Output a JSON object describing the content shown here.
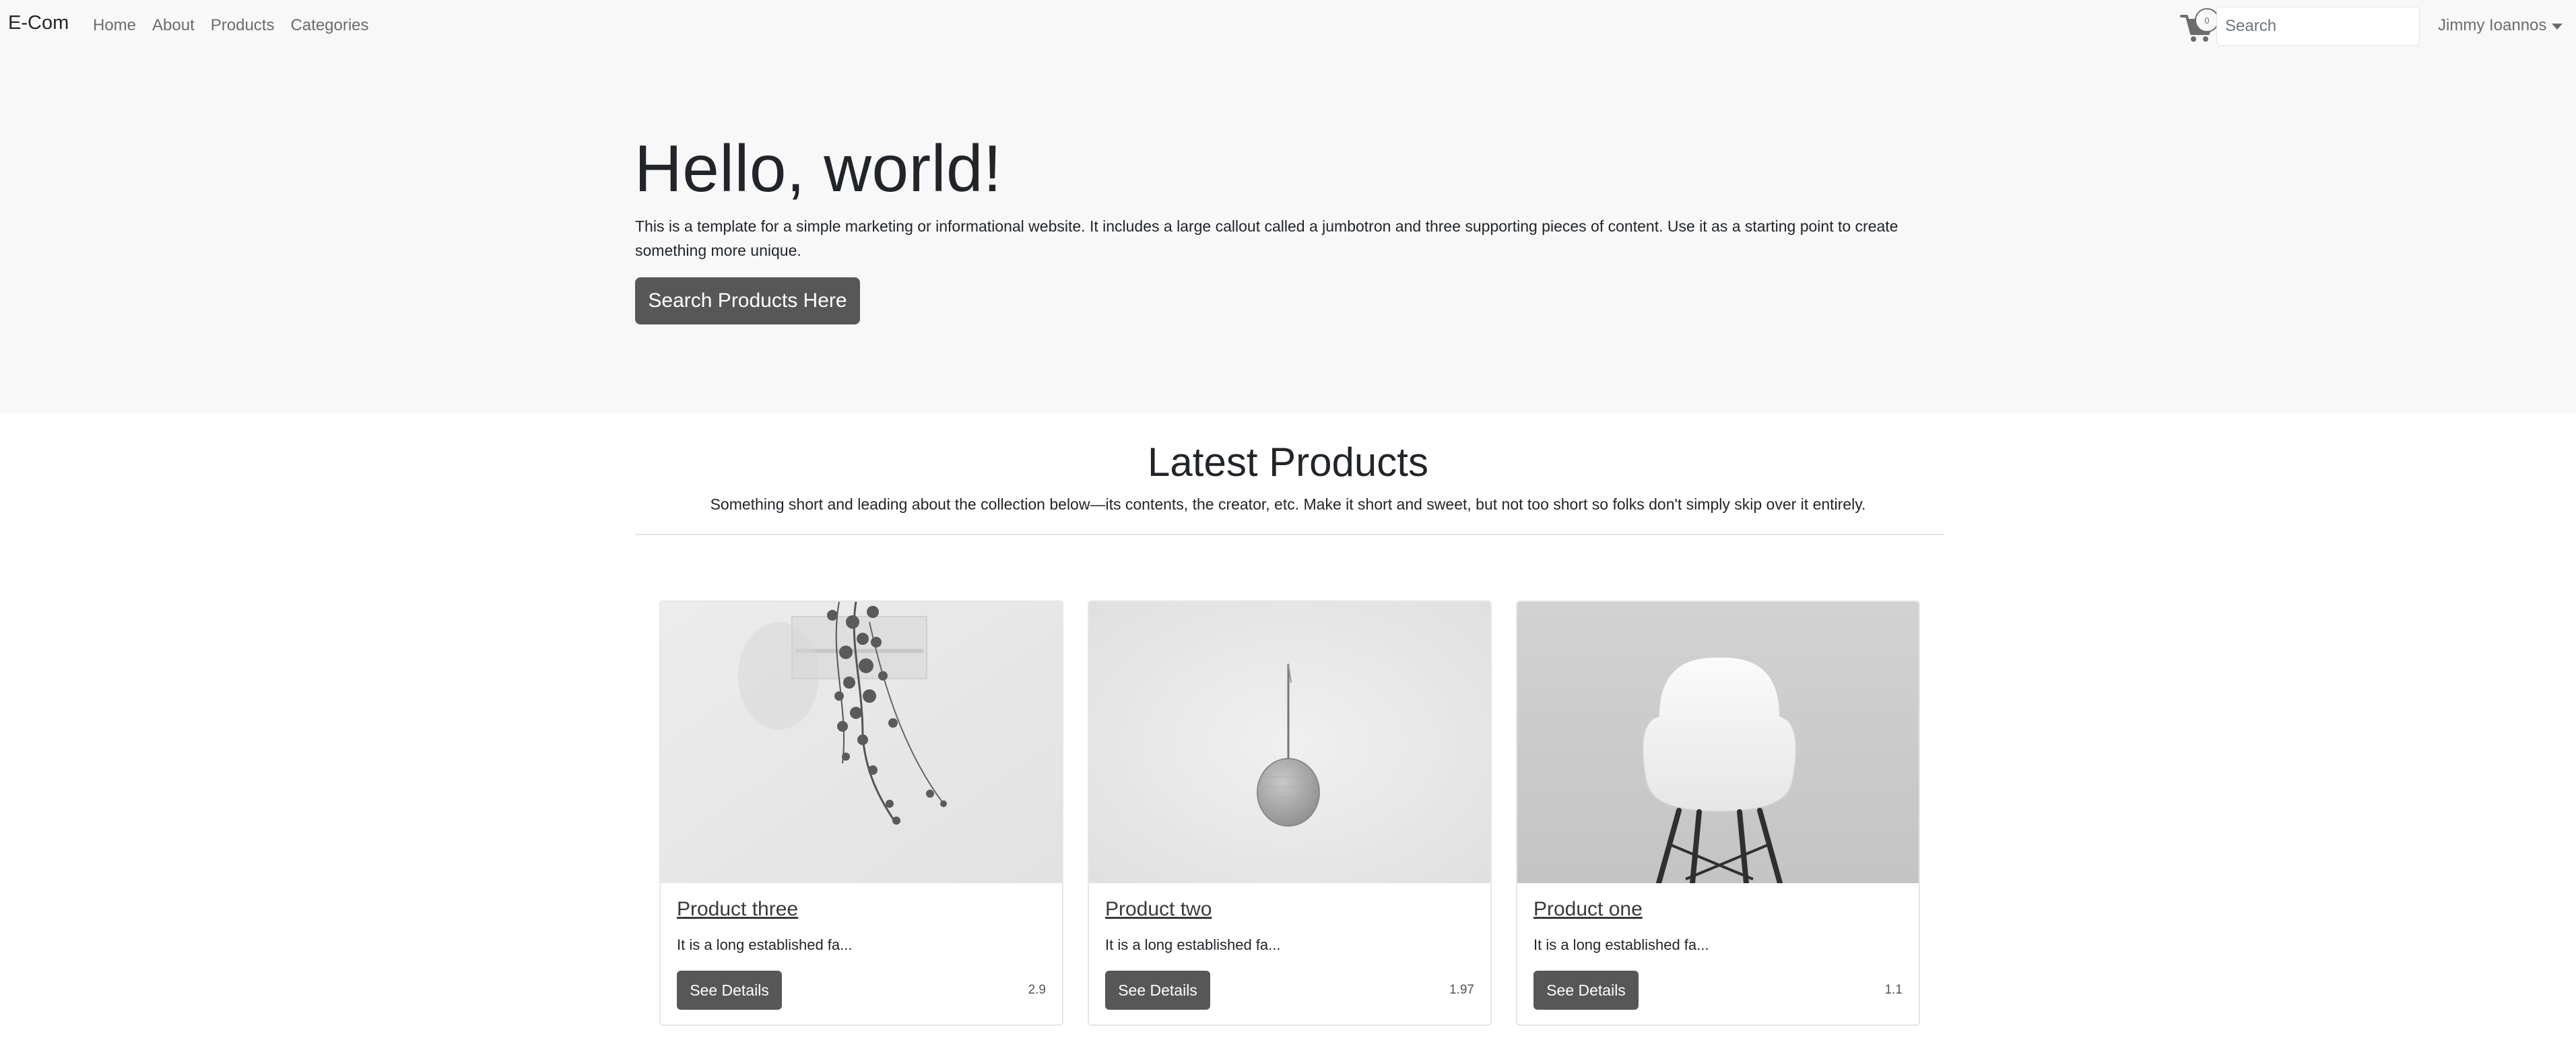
{
  "navbar": {
    "brand": "E-Com",
    "links": [
      "Home",
      "About",
      "Products",
      "Categories"
    ],
    "cart_count": "0",
    "search_placeholder": "Search",
    "user_name": "Jimmy Ioannos"
  },
  "jumbotron": {
    "title": "Hello, world!",
    "text": "This is a template for a simple marketing or informational website. It includes a large callout called a jumbotron and three supporting pieces of content. Use it as a starting point to create something more unique.",
    "button_label": "Search Products Here"
  },
  "latest": {
    "title": "Latest Products",
    "lead": "Something short and leading about the collection below—its contents, the creator, etc. Make it short and sweet, but not too short so folks don't simply skip over it entirely."
  },
  "products": [
    {
      "title": "Product three",
      "description": "It is a long established fa...",
      "button_label": "See Details",
      "price": "2.9",
      "image": "hanging-ivy-plant"
    },
    {
      "title": "Product two",
      "description": "It is a long established fa...",
      "button_label": "See Details",
      "price": "1.97",
      "image": "round-wall-speaker"
    },
    {
      "title": "Product one",
      "description": "It is a long established fa...",
      "button_label": "See Details",
      "price": "1.1",
      "image": "white-shell-chair"
    }
  ],
  "colors": {
    "navbar_bg": "#f8f8f8",
    "button_bg": "#575757",
    "link_color": "#6c6c6c"
  }
}
